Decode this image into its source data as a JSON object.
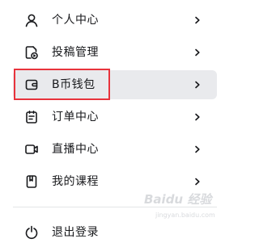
{
  "menu": {
    "items": [
      {
        "label": "个人中心",
        "icon": "user-icon",
        "active": false
      },
      {
        "label": "投稿管理",
        "icon": "upload-video-icon",
        "active": false
      },
      {
        "label": "B币钱包",
        "icon": "wallet-icon",
        "active": true
      },
      {
        "label": "订单中心",
        "icon": "order-icon",
        "active": false
      },
      {
        "label": "直播中心",
        "icon": "live-camera-icon",
        "active": false
      },
      {
        "label": "我的课程",
        "icon": "course-book-icon",
        "active": false
      }
    ],
    "logout_label": "退出登录"
  },
  "watermark": {
    "logo": "Baidu 经验",
    "sub": "jingyan.baidu.com"
  },
  "colors": {
    "active_bg": "#e9eaed",
    "highlight_border": "#e8333c",
    "text": "#18191c",
    "icon": "#61666d"
  }
}
